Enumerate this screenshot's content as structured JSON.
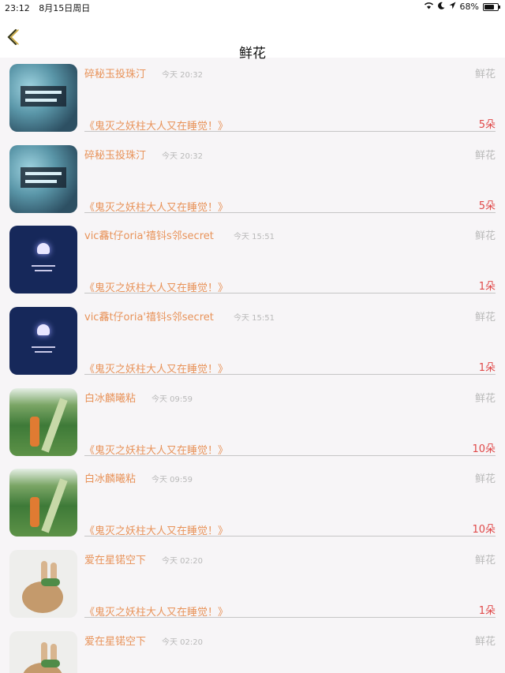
{
  "status_bar": {
    "time": "23:12",
    "date": "8月15日周日",
    "battery": "68%"
  },
  "nav": {
    "title": "鲜花"
  },
  "rows": [
    {
      "name": "碎秘玉投珠汀",
      "time": "今天 20:32",
      "gift": "鲜花",
      "story": "《鬼灭之妖柱大人又在睡觉！》",
      "amount": "5朵",
      "thumb": "galaxy"
    },
    {
      "name": "碎秘玉投珠汀",
      "time": "今天 20:32",
      "gift": "鲜花",
      "story": "《鬼灭之妖柱大人又在睡觉！》",
      "amount": "5朵",
      "thumb": "galaxy"
    },
    {
      "name": "vic馫t仔oria'禧钭s邻secret",
      "time": "今天 15:51",
      "gift": "鲜花",
      "story": "《鬼灭之妖柱大人又在睡觉！》",
      "amount": "1朵",
      "thumb": "navy"
    },
    {
      "name": "vic馫t仔oria'禧钭s邻secret",
      "time": "今天 15:51",
      "gift": "鲜花",
      "story": "《鬼灭之妖柱大人又在睡觉！》",
      "amount": "1朵",
      "thumb": "navy"
    },
    {
      "name": "白冰麟曦粘",
      "time": "今天 09:59",
      "gift": "鲜花",
      "story": "《鬼灭之妖柱大人又在睡觉！》",
      "amount": "10朵",
      "thumb": "forest"
    },
    {
      "name": "白冰麟曦粘",
      "time": "今天 09:59",
      "gift": "鲜花",
      "story": "《鬼灭之妖柱大人又在睡觉！》",
      "amount": "10朵",
      "thumb": "forest"
    },
    {
      "name": "爱在星锘空下",
      "time": "今天 02:20",
      "gift": "鲜花",
      "story": "《鬼灭之妖柱大人又在睡觉！》",
      "amount": "1朵",
      "thumb": "bunny"
    },
    {
      "name": "爱在星锘空下",
      "time": "今天 02:20",
      "gift": "鲜花",
      "story": "",
      "amount": "",
      "thumb": "bunny"
    }
  ],
  "colors": {
    "accent_orange": "#e8935a",
    "amount_red": "#e04848",
    "muted_gray": "#b9b9b9"
  }
}
